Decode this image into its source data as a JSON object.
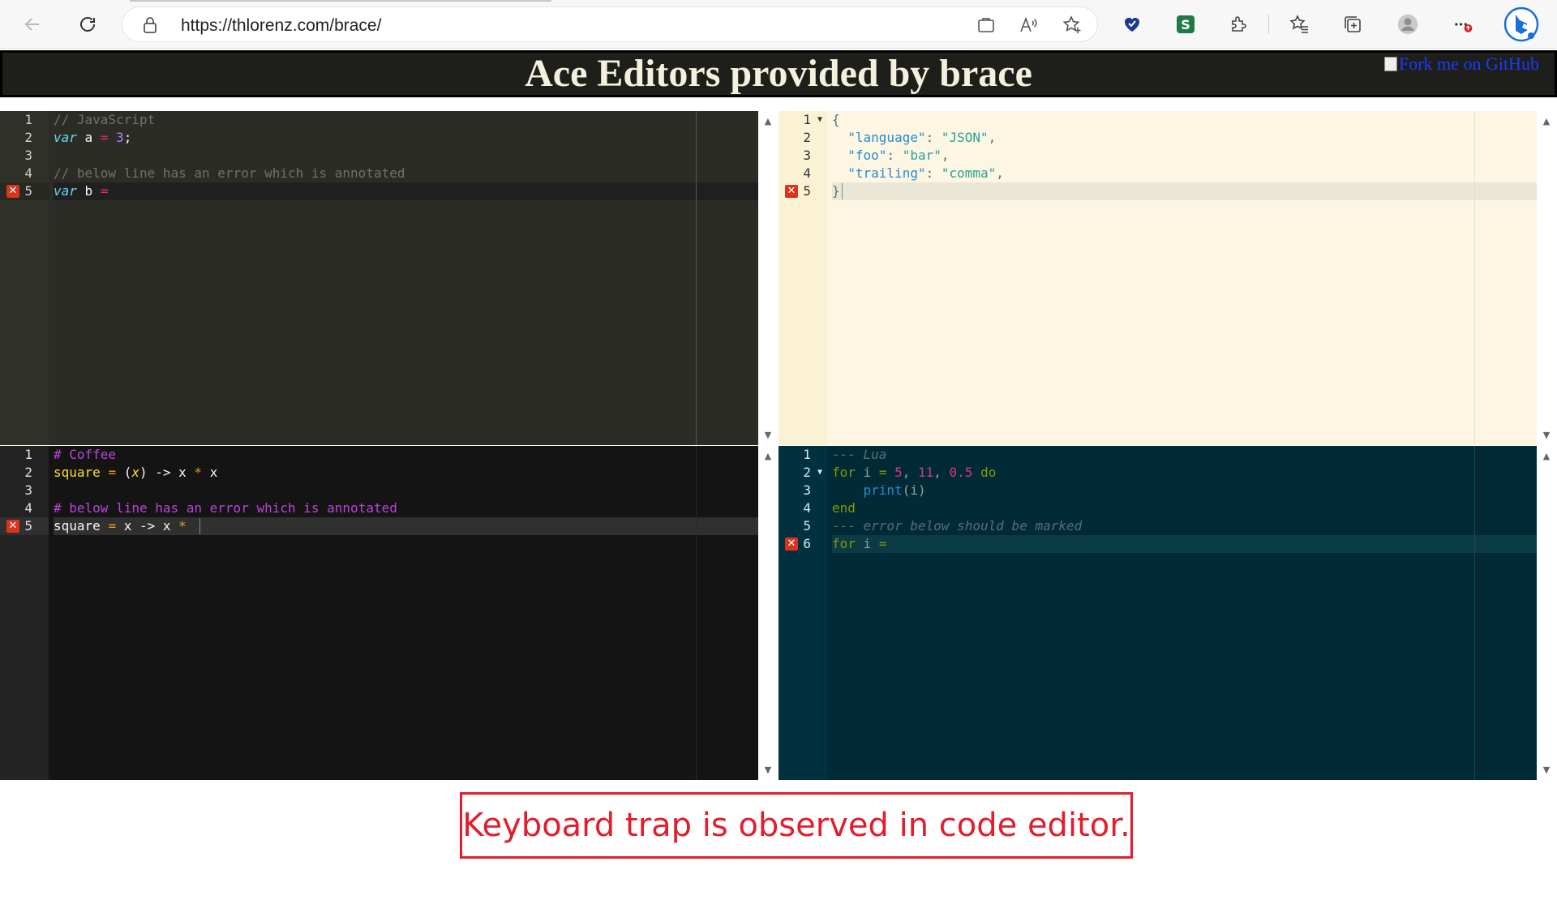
{
  "browser": {
    "url": "https://thlorenz.com/brace/"
  },
  "page": {
    "title": "Ace Editors provided by brace",
    "fork_link_text": "Fork me on GitHub"
  },
  "editors": {
    "javascript": {
      "theme": "monokai",
      "lines": [
        "// JavaScript",
        "var a = 3;",
        "",
        "// below line has an error which is annotated",
        "var b ="
      ],
      "line_numbers": [
        "1",
        "2",
        "3",
        "4",
        "5"
      ],
      "error_line": 5
    },
    "json": {
      "theme": "solarized_light",
      "lines": [
        "{",
        "  \"language\": \"JSON\",",
        "  \"foo\": \"bar\",",
        "  \"trailing\": \"comma\",",
        "}"
      ],
      "line_numbers": [
        "1",
        "2",
        "3",
        "4",
        "5"
      ],
      "error_line": 5
    },
    "coffee": {
      "theme": "dark",
      "lines": [
        "# Coffee",
        "square = (x) -> x * x",
        "",
        "# below line has an error which is annotated",
        "square = x -> x * "
      ],
      "line_numbers": [
        "1",
        "2",
        "3",
        "4",
        "5"
      ],
      "error_line": 5
    },
    "lua": {
      "theme": "solarized_dark",
      "lines": [
        "--- Lua",
        "for i = 5, 11, 0.5 do",
        "    print(i)",
        "end",
        "--- error below should be marked",
        "for i ="
      ],
      "line_numbers": [
        "1",
        "2",
        "3",
        "4",
        "5",
        "6"
      ],
      "error_line": 6
    }
  },
  "annotation": {
    "text": "Keyboard trap is observed in code editor."
  },
  "colors": {
    "annotation_red": "#e31d2b"
  }
}
